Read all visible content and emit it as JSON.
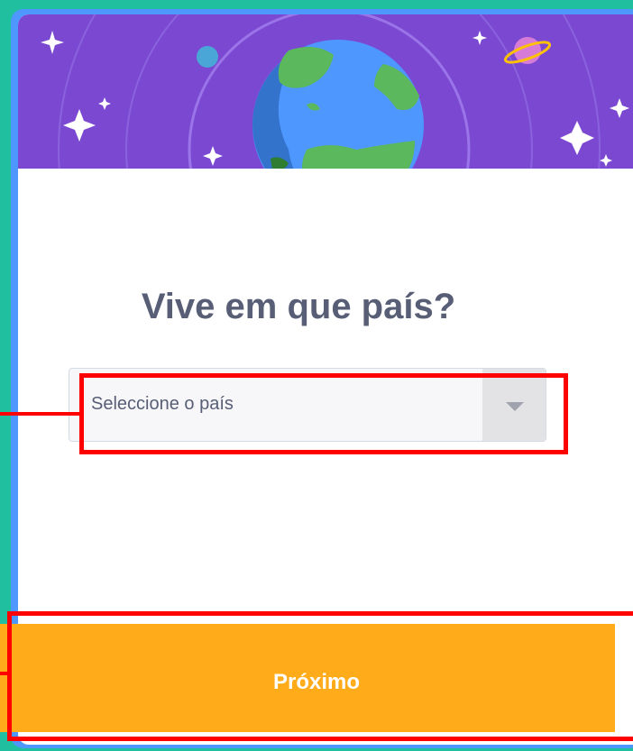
{
  "modal": {
    "title": "Vive em que país?",
    "country_select": {
      "placeholder": "Seleccione o país"
    },
    "next_button_label": "Próximo"
  },
  "colors": {
    "background": "#1fbf9f",
    "modal_border": "#4d97ff",
    "header": "#7b49d1",
    "title_text": "#575e75",
    "next_button": "#ffab1a",
    "highlight": "#ff0000"
  },
  "icons": {
    "header_art": "earth-globe-icon",
    "select_arrow": "caret-down-icon"
  }
}
